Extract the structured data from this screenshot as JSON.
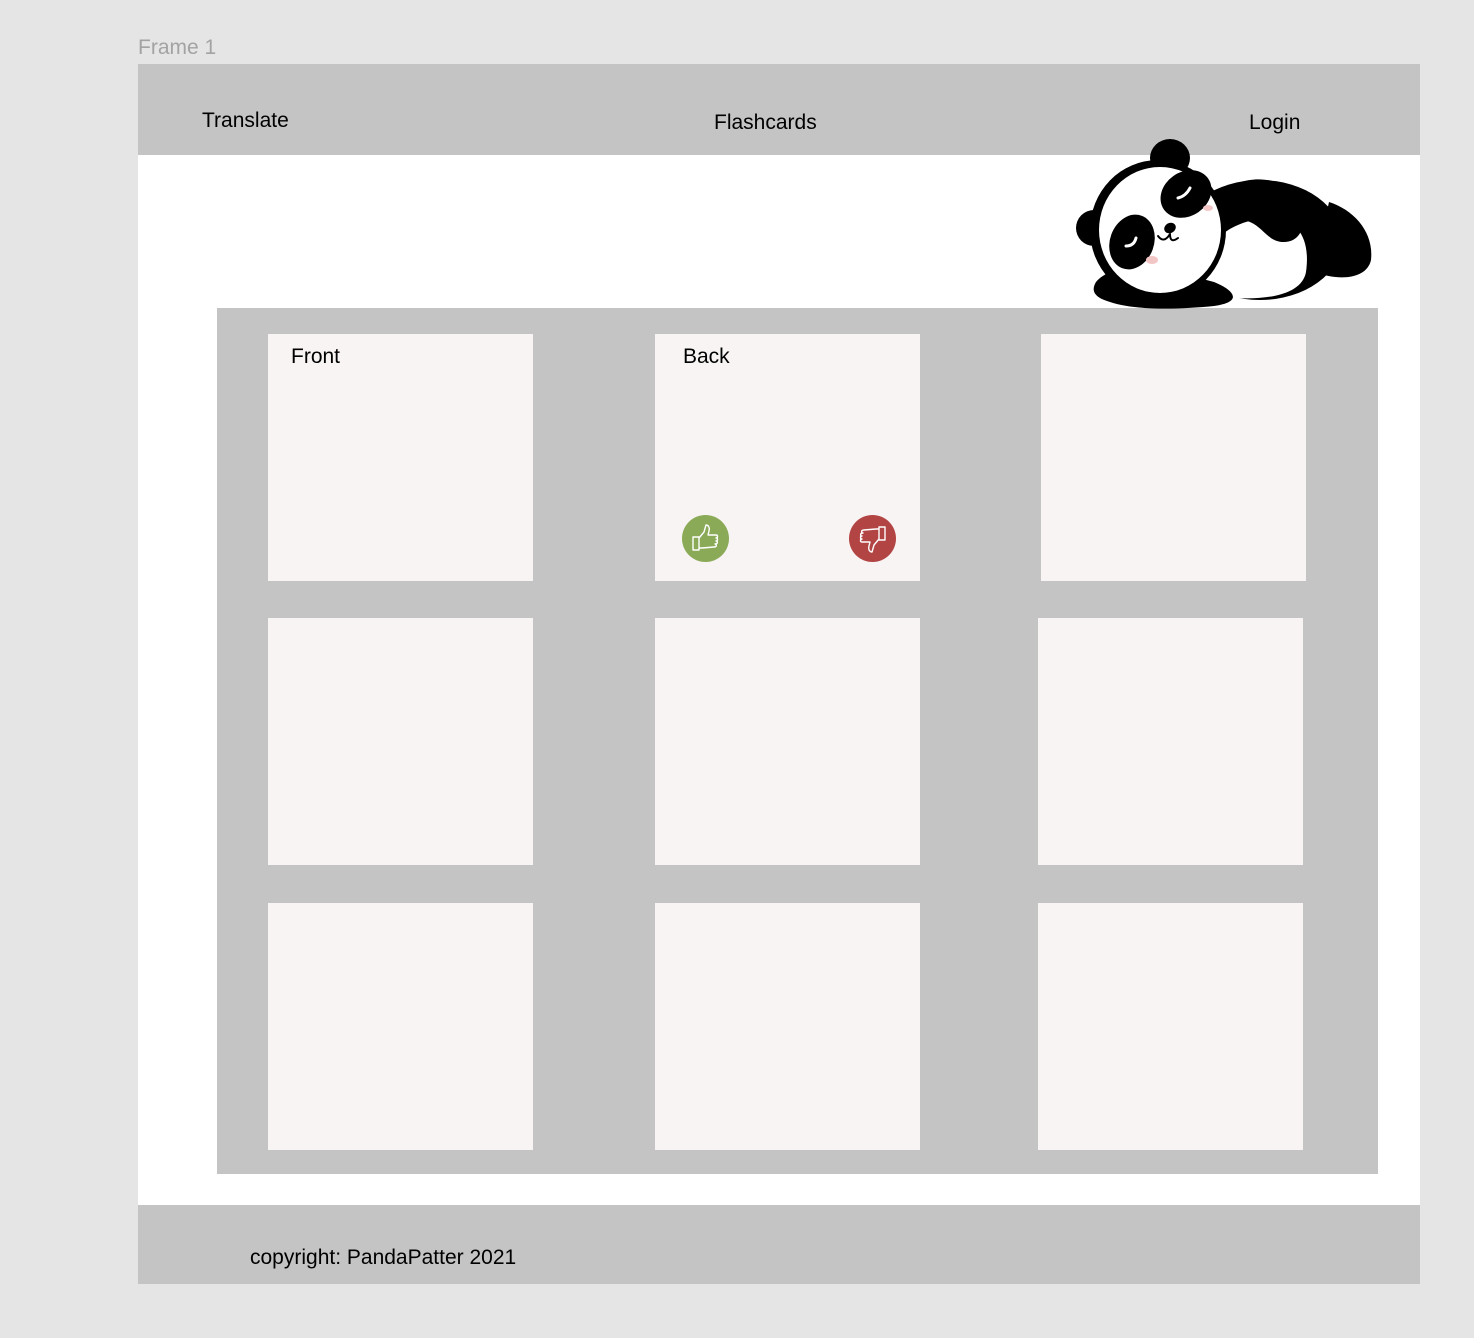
{
  "frame": {
    "label": "Frame 1"
  },
  "header": {
    "nav": {
      "translate": "Translate",
      "flashcards": "Flashcards",
      "login": "Login"
    }
  },
  "mascot": {
    "icon": "sleeping-panda-icon"
  },
  "flashcards": {
    "front_label": "Front",
    "back_label": "Back",
    "thumbs_up": {
      "icon": "thumbs-up-icon",
      "color": "#8aaa58"
    },
    "thumbs_down": {
      "icon": "thumbs-down-icon",
      "color": "#b34444"
    }
  },
  "footer": {
    "copyright": "copyright: PandaPatter 2021"
  },
  "colors": {
    "canvas": "#e5e5e5",
    "bars": "#c4c4c4",
    "card": "#f9f4f4",
    "frame_label": "#a3a3a3"
  }
}
